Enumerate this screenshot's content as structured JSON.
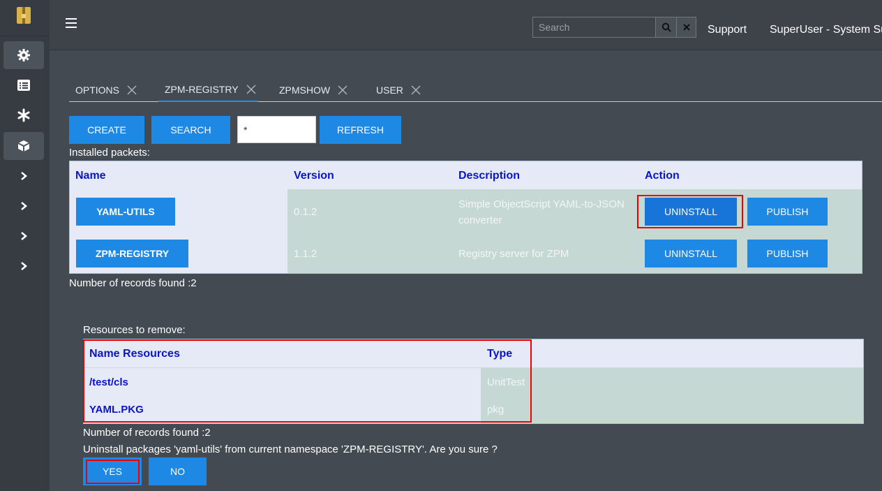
{
  "header": {
    "search_placeholder": "Search",
    "support_label": "Support",
    "user_label": "SuperUser - System Su"
  },
  "sidebar": {
    "items": [
      {
        "icon": "gear-icon"
      },
      {
        "icon": "list-icon"
      },
      {
        "icon": "asterisk-icon"
      },
      {
        "icon": "package-icon"
      },
      {
        "icon": "chevron-right-icon"
      },
      {
        "icon": "chevron-right-icon"
      },
      {
        "icon": "chevron-right-icon"
      },
      {
        "icon": "chevron-right-icon"
      }
    ]
  },
  "tabs": [
    {
      "label": "OPTIONS"
    },
    {
      "label": "ZPM-REGISTRY"
    },
    {
      "label": "ZPMSHOW"
    },
    {
      "label": "USER"
    }
  ],
  "toolbar": {
    "create_label": "CREATE",
    "search_label": "SEARCH",
    "filter_value": "*",
    "refresh_label": "REFRESH"
  },
  "packets": {
    "title": "Installed packets:",
    "headers": {
      "name": "Name",
      "version": "Version",
      "description": "Description",
      "action": "Action"
    },
    "rows": [
      {
        "name": "YAML-UTILS",
        "version": "0.1.2",
        "description": "Simple ObjectScript YAML-to-JSON converter",
        "uninstall": "UNINSTALL",
        "publish": "PUBLISH"
      },
      {
        "name": "ZPM-REGISTRY",
        "version": "1.1.2",
        "description": "Registry server for ZPM",
        "uninstall": "UNINSTALL",
        "publish": "PUBLISH"
      }
    ],
    "count_text": "Number of records found :2"
  },
  "resources": {
    "title": "Resources to remove:",
    "headers": {
      "name": "Name Resources",
      "type": "Type"
    },
    "rows": [
      {
        "name": "/test/cls",
        "type": "UnitTest"
      },
      {
        "name": "YAML.PKG",
        "type": "pkg"
      }
    ],
    "count_text": "Number of records found :2"
  },
  "confirm": {
    "message": "Uninstall packages 'yaml-utils' from current namespace 'ZPM-REGISTRY'. Are you sure ?",
    "yes_label": "YES",
    "no_label": "NO"
  },
  "colors": {
    "accent": "#1e88e5",
    "header_text": "#0a14c8",
    "highlight": "#e00000"
  }
}
